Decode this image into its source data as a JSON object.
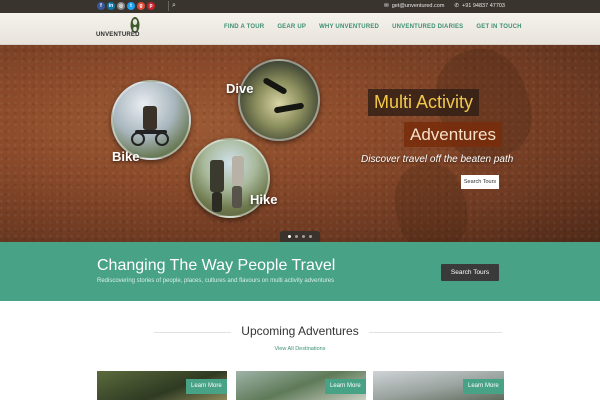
{
  "topbar": {
    "social": [
      "f",
      "in",
      "◎",
      "t",
      "g",
      "p"
    ],
    "social_colors": [
      "#3b5998",
      "#0e76a8",
      "#888888",
      "#1da1f2",
      "#dd4b39",
      "#c8232c"
    ],
    "email_icon": "envelope-icon",
    "email": "get@unventured.com",
    "phone_icon": "phone-icon",
    "phone": "+91 94837 47703"
  },
  "logo": {
    "text": "UNVENTURED"
  },
  "nav": [
    "FIND A TOUR",
    "GEAR UP",
    "WHY UNVENTURED",
    "UNVENTURED DIARIES",
    "GET IN TOUCH"
  ],
  "hero": {
    "bike": "Bike",
    "dive": "Dive",
    "hike": "Hike",
    "title_line1": "Multi Activity",
    "title_line2": "Adventures",
    "tagline": "Discover travel off the beaten path",
    "button": "Search Tours",
    "slides": 4,
    "active_slide": 1
  },
  "band": {
    "heading": "Changing The Way People Travel",
    "sub": "Rediscovering stories of people, places, cultures and flavours on multi activity adventures",
    "button": "Search Tours"
  },
  "upcoming": {
    "heading": "Upcoming Adventures",
    "link": "View All Destinations",
    "cards": [
      {
        "button": "Learn More"
      },
      {
        "button": "Learn More"
      },
      {
        "button": "Learn More"
      }
    ]
  },
  "colors": {
    "accent": "#48a286",
    "nav_text": "#3d8f74",
    "topbar": "#3a342f"
  }
}
